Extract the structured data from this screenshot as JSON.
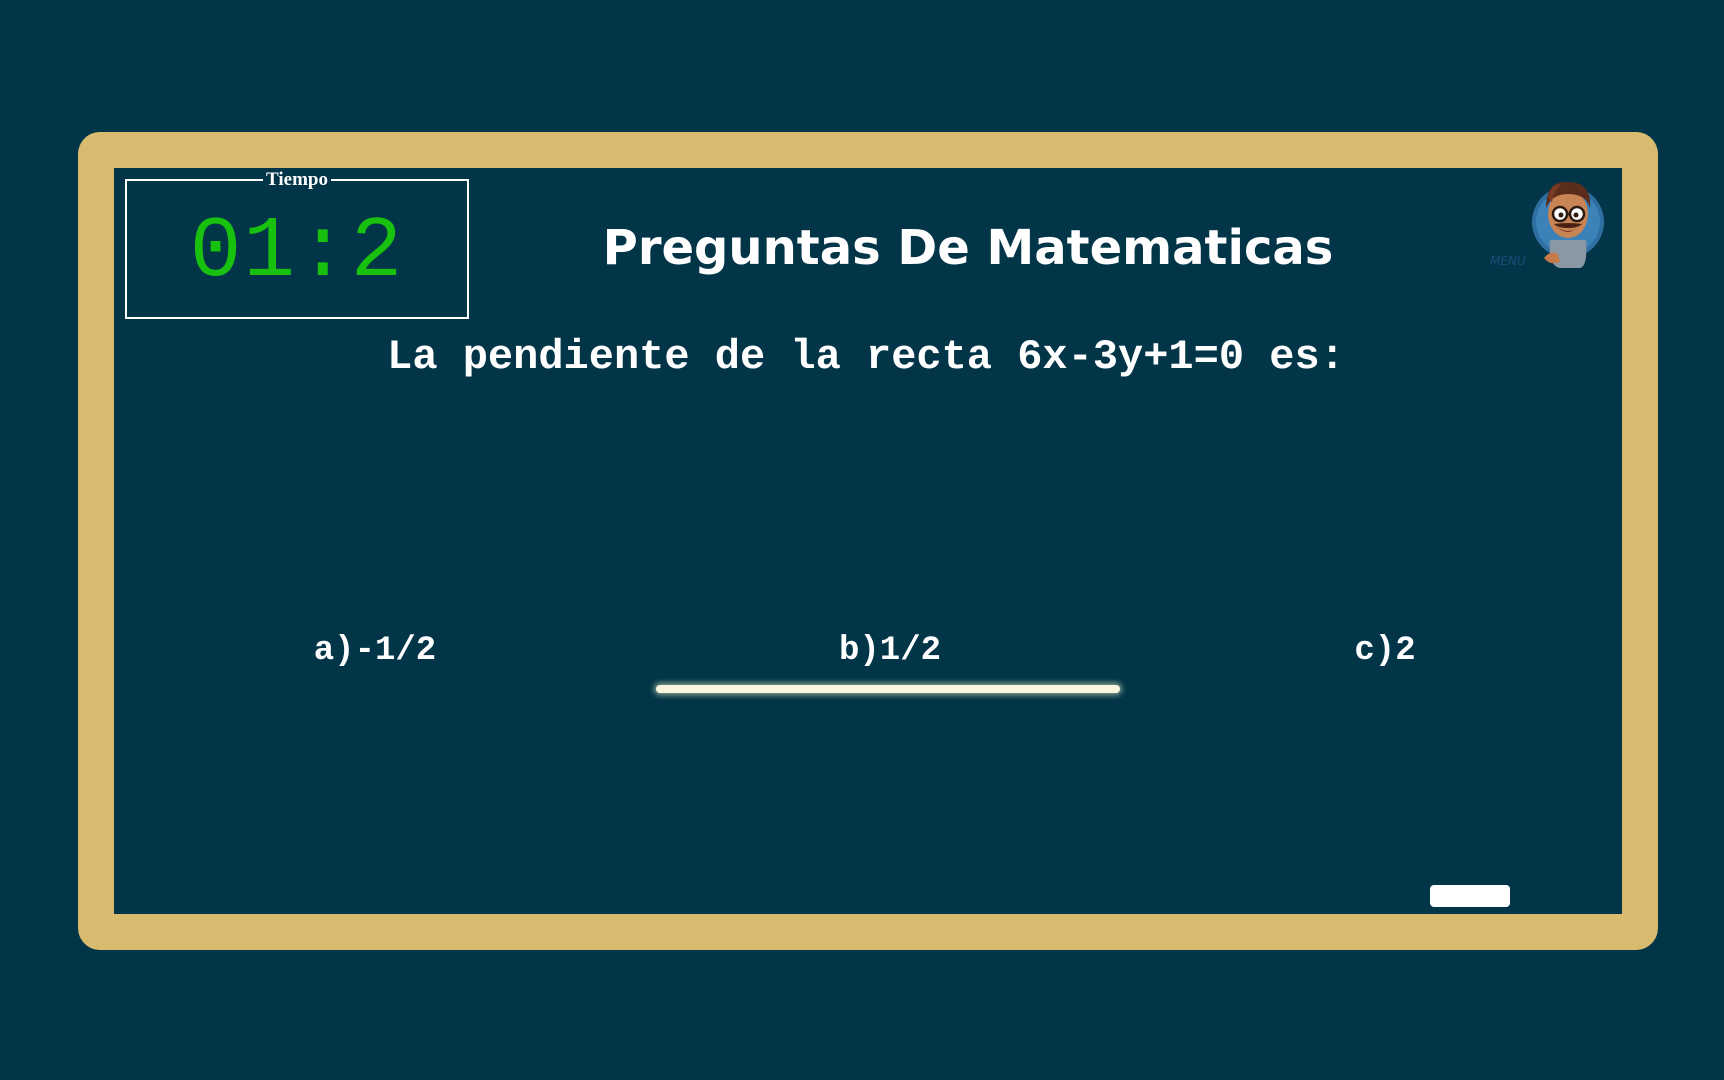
{
  "header": {
    "timer_label": "Tiempo",
    "timer_value": "01:2",
    "title": "Preguntas De Matematicas"
  },
  "menu": {
    "label": "MENÚ",
    "icon": "teacher-avatar-icon"
  },
  "question": {
    "text": "La pendiente de la recta 6x-3y+1=0 es:"
  },
  "options": [
    {
      "label": "a)-1/2"
    },
    {
      "label": "b)1/2"
    },
    {
      "label": "c)2"
    }
  ],
  "colors": {
    "board": "#013547",
    "frame": "#d8bb6f",
    "timer": "#19c10f",
    "text": "#ffffff"
  }
}
